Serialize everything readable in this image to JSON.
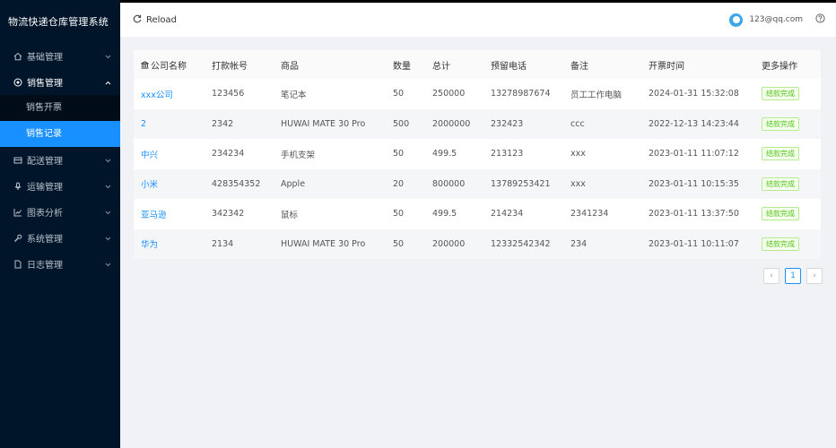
{
  "app": {
    "title": "物流快递仓库管理系统"
  },
  "sidebar": {
    "items": [
      {
        "label": "基础管理",
        "icon": "home-icon"
      },
      {
        "label": "销售管理",
        "icon": "sales-icon"
      },
      {
        "label": "配送管理",
        "icon": "truck-icon"
      },
      {
        "label": "运输管理",
        "icon": "transport-icon"
      },
      {
        "label": "图表分析",
        "icon": "chart-icon"
      },
      {
        "label": "系统管理",
        "icon": "wrench-icon"
      },
      {
        "label": "日志管理",
        "icon": "file-icon"
      }
    ],
    "submenu": [
      {
        "label": "销售开票"
      },
      {
        "label": "销售记录"
      }
    ]
  },
  "header": {
    "reload_label": "Reload",
    "email": "123@qq.com"
  },
  "table": {
    "headers": [
      "公司名称",
      "打款帐号",
      "商品",
      "数量",
      "总计",
      "预留电话",
      "备注",
      "开票时间",
      "更多操作"
    ],
    "rows": [
      {
        "company": "xxx公司",
        "account": "123456",
        "product": "笔记本",
        "qty": "50",
        "total": "250000",
        "phone": "13278987674",
        "note": "员工工作电脑",
        "time": "2024-01-31 15:32:08",
        "status": "结款完成"
      },
      {
        "company": "2",
        "account": "2342",
        "product": "HUWAI MATE 30 Pro",
        "qty": "500",
        "total": "2000000",
        "phone": "232423",
        "note": "ccc",
        "time": "2022-12-13 14:23:44",
        "status": "结款完成"
      },
      {
        "company": "中兴",
        "account": "234234",
        "product": "手机支架",
        "qty": "50",
        "total": "499.5",
        "phone": "213123",
        "note": "xxx",
        "time": "2023-01-11 11:07:12",
        "status": "结款完成"
      },
      {
        "company": "小米",
        "account": "428354352",
        "product": "Apple",
        "qty": "20",
        "total": "800000",
        "phone": "13789253421",
        "note": "xxx",
        "time": "2023-01-11 10:15:35",
        "status": "结款完成"
      },
      {
        "company": "亚马逊",
        "account": "342342",
        "product": "鼠标",
        "qty": "50",
        "total": "499.5",
        "phone": "214234",
        "note": "2341234",
        "time": "2023-01-11 13:37:50",
        "status": "结款完成"
      },
      {
        "company": "华为",
        "account": "2134",
        "product": "HUWAI MATE 30 Pro",
        "qty": "50",
        "total": "200000",
        "phone": "12332542342",
        "note": "234",
        "time": "2023-01-11 10:11:07",
        "status": "结款完成"
      }
    ]
  },
  "pagination": {
    "current": "1",
    "prev": "‹",
    "next": "›"
  },
  "colors": {
    "sidebar_bg": "#001529",
    "accent": "#1890ff",
    "success": "#52c41a",
    "content_bg": "#f0f2f5"
  }
}
